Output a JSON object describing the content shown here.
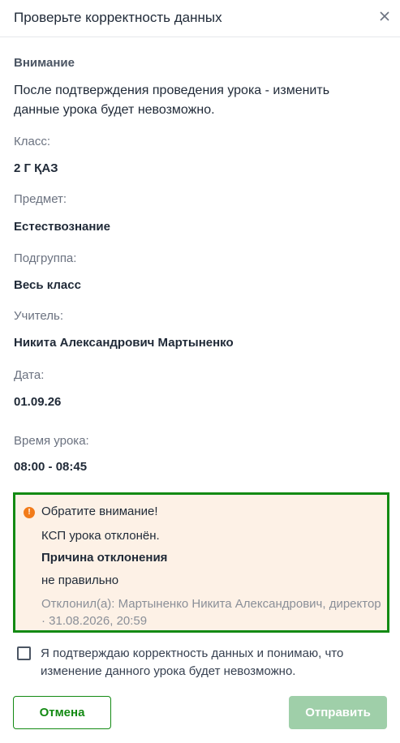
{
  "header": {
    "title": "Проверьте корректность данных",
    "close_icon": "close-icon"
  },
  "warning": {
    "title": "Внимание",
    "text": "После подтверждения проведения урока - изменить данные урока будет невозможно."
  },
  "fields": {
    "class": {
      "label": "Класс:",
      "value": "2 Г ҚАЗ"
    },
    "subject": {
      "label": "Предмет:",
      "value": "Естествознание"
    },
    "subgroup": {
      "label": "Подгруппа:",
      "value": "Весь класс"
    },
    "teacher": {
      "label": "Учитель:",
      "value": "Никита Александрович Мартыненко"
    },
    "date": {
      "label": "Дата:",
      "value": "01.09.26"
    },
    "time": {
      "label": "Время урока:",
      "value": "08:00 - 08:45"
    }
  },
  "notice": {
    "icon": "info-icon",
    "icon_glyph": "!",
    "title": "Обратите внимание!",
    "status": "КСП урока отклонён.",
    "reason_label": "Причина отклонения",
    "reason": "не правильно",
    "meta": "Отклонил(а): Мартыненко Никита Александрович, директор · 31.08.2026, 20:59"
  },
  "confirm": {
    "checked": false,
    "text": "Я подтверждаю корректность данных и понимаю, что изменение данного урока будет невозможно."
  },
  "buttons": {
    "cancel": "Отмена",
    "send": "Отправить"
  },
  "colors": {
    "accent": "#138a13",
    "notice_bg": "#fdf1e6",
    "info_icon": "#f27b1a",
    "send_disabled": "#9fcfa9"
  }
}
